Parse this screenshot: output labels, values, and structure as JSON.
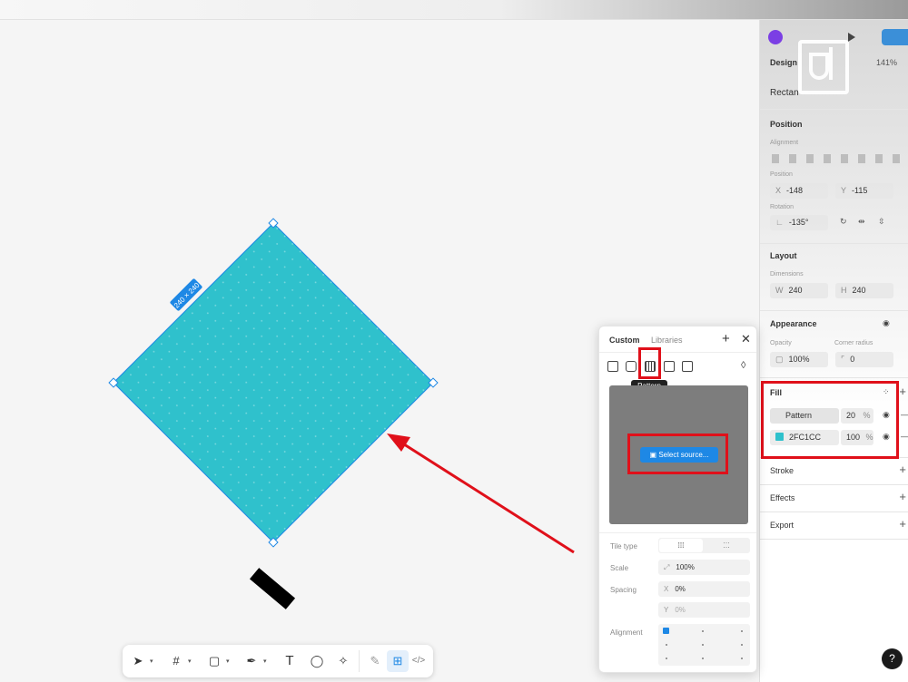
{
  "canvas": {
    "dimension_badge": "240 × 240"
  },
  "right_panel": {
    "tab_design": "Design",
    "zoom": "141%",
    "layer_name": "Rectan",
    "position": {
      "title": "Position",
      "alignment_label": "Alignment",
      "position_label": "Position",
      "x_key": "X",
      "x_value": "-148",
      "y_key": "Y",
      "y_value": "-115",
      "rotation_label": "Rotation",
      "rotation_value": "-135°"
    },
    "layout": {
      "title": "Layout",
      "dimensions_label": "Dimensions",
      "w_key": "W",
      "w_value": "240",
      "h_key": "H",
      "h_value": "240"
    },
    "appearance": {
      "title": "Appearance",
      "opacity_label": "Opacity",
      "opacity_value": "100%",
      "radius_label": "Corner radius",
      "radius_value": "0"
    },
    "fill": {
      "title": "Fill",
      "layers": [
        {
          "name": "Pattern",
          "opacity": "20",
          "unit": "%"
        },
        {
          "name": "2FC1CC",
          "opacity": "100",
          "unit": "%",
          "color": "#2FC1CC"
        }
      ]
    },
    "stroke_title": "Stroke",
    "effects_title": "Effects",
    "export_title": "Export"
  },
  "popup": {
    "tabs": [
      "Custom",
      "Libraries"
    ],
    "tooltip": "Pattern",
    "select_source": "Select source...",
    "tile_type_label": "Tile type",
    "scale_label": "Scale",
    "scale_value": "100%",
    "spacing_label": "Spacing",
    "spacing_x_key": "X",
    "spacing_x_value": "0%",
    "spacing_y_key": "Y",
    "spacing_y_value": "0%",
    "alignment_label": "Alignment"
  },
  "help": "?",
  "colors": {
    "shape_fill": "#2FC1CC",
    "accent": "#1e88e5",
    "highlight": "#e0101a"
  }
}
